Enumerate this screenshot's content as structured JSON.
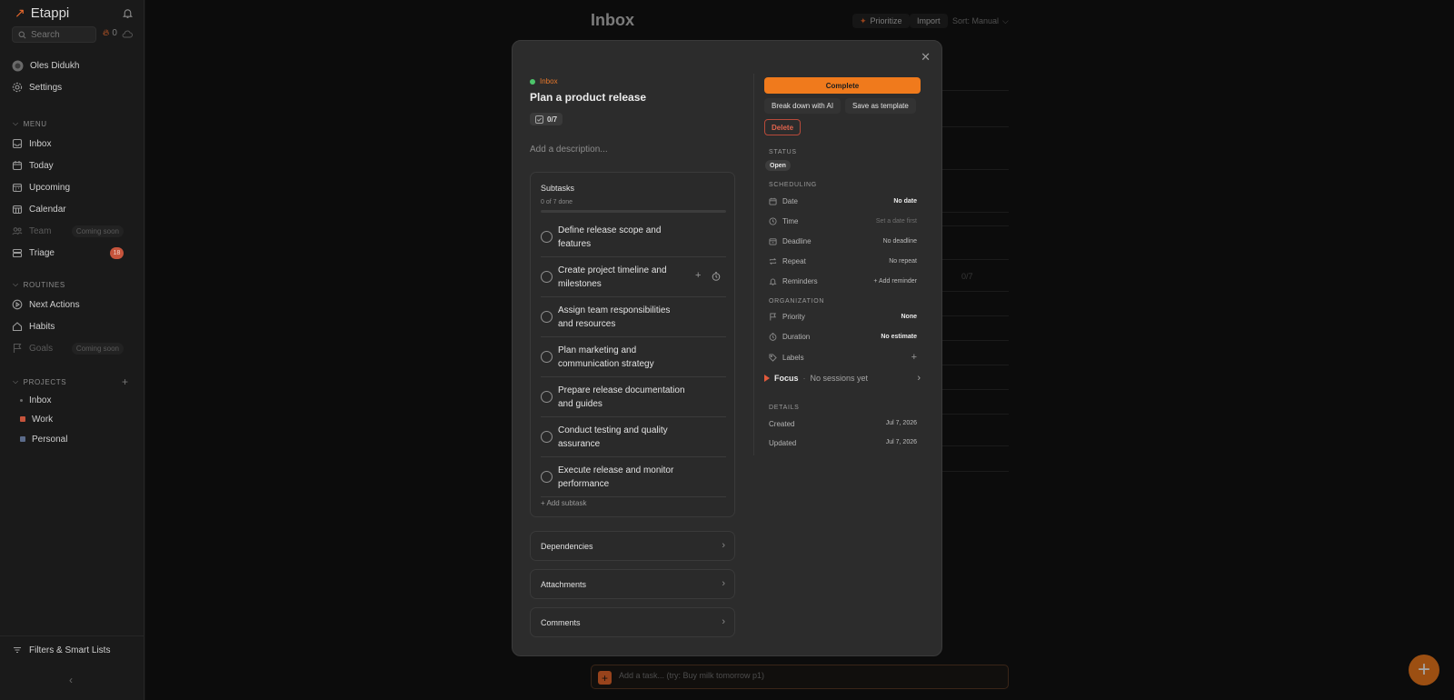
{
  "sidebar": {
    "brand": "Etappi",
    "search_placeholder": "Search",
    "streak_count": "0",
    "user_name": "Oles Didukh",
    "settings_label": "Settings",
    "menu_heading": "MENU",
    "menu_items": [
      {
        "label": "Inbox"
      },
      {
        "label": "Today"
      },
      {
        "label": "Upcoming"
      },
      {
        "label": "Calendar"
      },
      {
        "label": "Team",
        "badge": "Coming soon"
      },
      {
        "label": "Triage",
        "badge": "18"
      }
    ],
    "routines_heading": "ROUTINES",
    "routine_items": [
      {
        "label": "Next Actions"
      },
      {
        "label": "Habits"
      },
      {
        "label": "Goals",
        "badge": "Coming soon"
      }
    ],
    "projects_heading": "PROJECTS",
    "project_items": [
      {
        "label": "Inbox",
        "color": "#6b6b6b"
      },
      {
        "label": "Work",
        "color": "#c6543c"
      },
      {
        "label": "Personal",
        "color": "#5b6b8a"
      }
    ],
    "filters_label": "Filters & Smart Lists"
  },
  "main": {
    "title": "Inbox",
    "prioritize_label": "Prioritize",
    "import_label": "Import",
    "sort_label": "Sort: Manual",
    "bg_row_count": "0/7",
    "add_task_placeholder": "Add a task... (try: Buy milk tomorrow p1)"
  },
  "modal": {
    "breadcrumb": "Inbox",
    "title": "Plan a product release",
    "subtask_counter": "0/7",
    "description_placeholder": "Add a description...",
    "subtasks_heading": "Subtasks",
    "subtasks_progress": "0 of 7 done",
    "subtasks": [
      "Define release scope and features",
      "Create project timeline and milestones",
      "Assign team responsibilities and resources",
      "Plan marketing and communication strategy",
      "Prepare release documentation and guides",
      "Conduct testing and quality assurance",
      "Execute release and monitor performance"
    ],
    "add_subtask_label": "+ Add subtask",
    "dependencies_label": "Dependencies",
    "attachments_label": "Attachments",
    "comments_label": "Comments",
    "complete_label": "Complete",
    "breakdown_label": "Break down with AI",
    "save_template_label": "Save as template",
    "delete_label": "Delete",
    "status_heading": "STATUS",
    "status_value": "Open",
    "scheduling_heading": "SCHEDULING",
    "scheduling": [
      {
        "label": "Date",
        "value": "No date"
      },
      {
        "label": "Time",
        "value": "Set a date first"
      },
      {
        "label": "Deadline",
        "value": "No deadline"
      },
      {
        "label": "Repeat",
        "value": "No repeat"
      },
      {
        "label": "Reminders",
        "value": "+ Add reminder"
      }
    ],
    "organization_heading": "ORGANIZATION",
    "organization": [
      {
        "label": "Priority",
        "value": "None"
      },
      {
        "label": "Duration",
        "value": "No estimate"
      },
      {
        "label": "Labels",
        "value": "+"
      }
    ],
    "focus_label": "Focus",
    "focus_sep": "·",
    "focus_status": "No sessions yet",
    "details_heading": "DETAILS",
    "details": [
      {
        "label": "Created",
        "value": "Jul 7, 2026"
      },
      {
        "label": "Updated",
        "value": "Jul 7, 2026"
      }
    ]
  },
  "colors": {
    "accent": "#f07a1c",
    "danger": "#e0644d",
    "inbox_dot": "#4cc46a"
  }
}
